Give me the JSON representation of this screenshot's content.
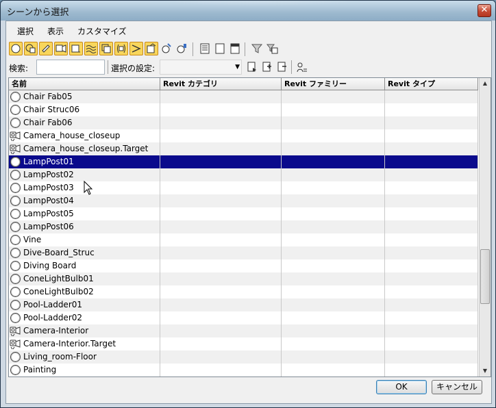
{
  "window": {
    "title": "シーンから選択",
    "close_symbol": "✕"
  },
  "menu": [
    "選択",
    "表示",
    "カスタマイズ"
  ],
  "toolbar": {
    "buttons": [
      {
        "icon": "geometry-icon",
        "active": true
      },
      {
        "icon": "shape-icon",
        "active": true
      },
      {
        "icon": "light-icon",
        "active": true
      },
      {
        "icon": "camera-icon",
        "active": true
      },
      {
        "icon": "helper-icon",
        "active": true
      },
      {
        "icon": "spacewarp-icon",
        "active": true
      },
      {
        "icon": "group-icon",
        "active": true
      },
      {
        "icon": "xref-icon",
        "active": true
      },
      {
        "icon": "bone-icon",
        "active": true
      },
      {
        "icon": "container-icon",
        "active": true
      },
      {
        "icon": "frozen-icon",
        "active": false
      },
      {
        "icon": "hidden-icon",
        "active": false
      },
      {
        "icon": "select-all-icon",
        "active": false
      },
      {
        "icon": "select-none-icon",
        "active": false
      },
      {
        "icon": "select-invert-icon",
        "active": false
      },
      {
        "icon": "filter-icon",
        "active": false
      },
      {
        "icon": "filter-options-icon",
        "active": false
      }
    ]
  },
  "search": {
    "label": "検索:",
    "value": ""
  },
  "selection_set": {
    "label": "選択の設定:",
    "value": ""
  },
  "columns": [
    "名前",
    "Revit カテゴリ",
    "Revit ファミリー",
    "Revit タイプ"
  ],
  "rows": [
    {
      "name": "Chair Fab05",
      "icon": "geometry-icon"
    },
    {
      "name": "Chair Struc06",
      "icon": "geometry-icon"
    },
    {
      "name": "Chair Fab06",
      "icon": "geometry-icon"
    },
    {
      "name": "Camera_house_closeup",
      "icon": "camera-icon"
    },
    {
      "name": "Camera_house_closeup.Target",
      "icon": "camera-icon"
    },
    {
      "name": "LampPost01",
      "icon": "geometry-icon",
      "selected": true
    },
    {
      "name": "LampPost02",
      "icon": "geometry-icon"
    },
    {
      "name": "LampPost03",
      "icon": "geometry-icon"
    },
    {
      "name": "LampPost04",
      "icon": "geometry-icon"
    },
    {
      "name": "LampPost05",
      "icon": "geometry-icon"
    },
    {
      "name": "LampPost06",
      "icon": "geometry-icon"
    },
    {
      "name": "Vine",
      "icon": "geometry-icon"
    },
    {
      "name": "Dive-Board_Struc",
      "icon": "geometry-icon"
    },
    {
      "name": "Diving Board",
      "icon": "geometry-icon"
    },
    {
      "name": "ConeLightBulb01",
      "icon": "geometry-icon"
    },
    {
      "name": "ConeLightBulb02",
      "icon": "geometry-icon"
    },
    {
      "name": "Pool-Ladder01",
      "icon": "geometry-icon"
    },
    {
      "name": "Pool-Ladder02",
      "icon": "geometry-icon"
    },
    {
      "name": "Camera-Interior",
      "icon": "camera-icon"
    },
    {
      "name": "Camera-Interior.Target",
      "icon": "camera-icon"
    },
    {
      "name": "Living_room-Floor",
      "icon": "geometry-icon"
    },
    {
      "name": "Painting",
      "icon": "geometry-icon"
    }
  ],
  "buttons": {
    "ok": "OK",
    "cancel": "キャンセル"
  },
  "colors": {
    "selection": "#0a0a8c",
    "toolbar_active": "#f8d65c"
  }
}
